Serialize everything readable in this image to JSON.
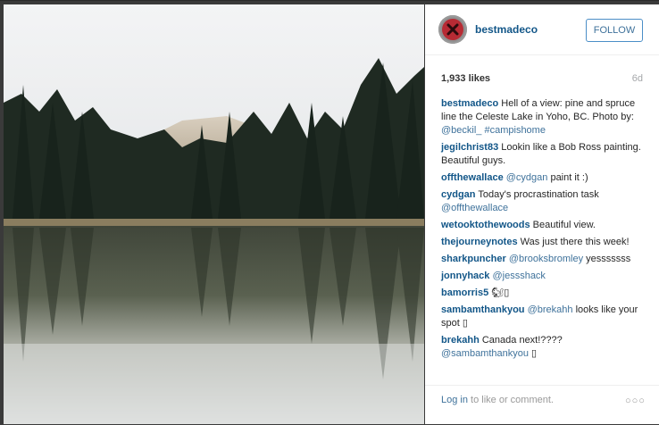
{
  "post": {
    "username": "bestmadeco",
    "follow_label": "FOLLOW",
    "likes": "1,933 likes",
    "age": "6d"
  },
  "comments": [
    {
      "user": "bestmadeco",
      "parts": [
        {
          "t": "Hell of a view: pine and spruce line the Celeste Lake in Yoho, BC. Photo by: "
        },
        {
          "t": "@beckil_",
          "link": true
        },
        {
          "t": " "
        },
        {
          "t": "#campishome",
          "link": true
        }
      ]
    },
    {
      "user": "jegilchrist83",
      "parts": [
        {
          "t": "Lookin like a Bob Ross painting. Beautiful guys."
        }
      ]
    },
    {
      "user": "offthewallace",
      "parts": [
        {
          "t": "@cydgan",
          "link": true
        },
        {
          "t": " paint it :)"
        }
      ]
    },
    {
      "user": "cydgan",
      "parts": [
        {
          "t": "Today's procrastination task "
        },
        {
          "t": "@offthewallace",
          "link": true
        }
      ]
    },
    {
      "user": "wetooktothewoods",
      "parts": [
        {
          "t": "Beautiful view."
        }
      ]
    },
    {
      "user": "thejourneynotes",
      "parts": [
        {
          "t": "Was just there this week!"
        }
      ]
    },
    {
      "user": "sharkpuncher",
      "parts": [
        {
          "t": "@brooksbromley",
          "link": true
        },
        {
          "t": " yesssssss"
        }
      ]
    },
    {
      "user": "jonnyhack",
      "parts": [
        {
          "t": "@jessshack",
          "link": true
        }
      ]
    },
    {
      "user": "bamorris5",
      "parts": [
        {
          "t": "🐿▯"
        }
      ]
    },
    {
      "user": "sambamthankyou",
      "parts": [
        {
          "t": "@brekahh",
          "link": true
        },
        {
          "t": " looks like your spot ▯"
        }
      ]
    },
    {
      "user": "brekahh",
      "parts": [
        {
          "t": "Canada next!???? "
        },
        {
          "t": "@sambamthankyou",
          "link": true
        },
        {
          "t": " ▯"
        }
      ]
    }
  ],
  "footer": {
    "login_link": "Log in",
    "login_text": " to like or comment.",
    "more": "○○○"
  },
  "icons": {
    "avatar": "x-logo-icon",
    "more": "more-options-icon"
  },
  "colors": {
    "username": "#125688",
    "link": "#3f729b",
    "follow_border": "#4b8ec7",
    "avatar_red": "#b72b34"
  }
}
